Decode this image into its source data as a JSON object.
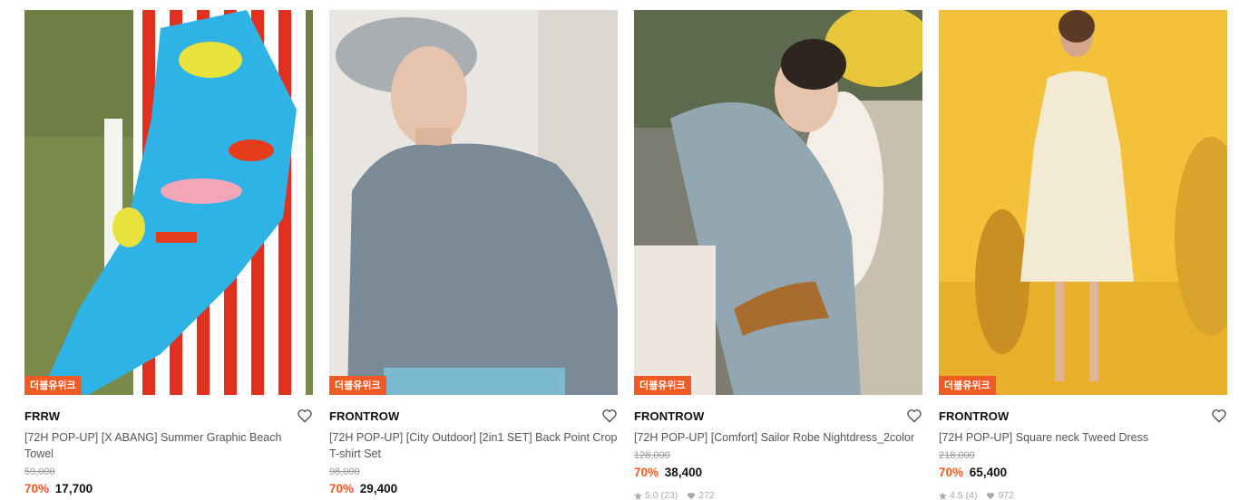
{
  "badge_label": "더블유위크",
  "products": [
    {
      "brand": "FRRW",
      "name": "[72H POP-UP] [X ABANG] Summer Graphic Beach Towel",
      "original_price": "59,000",
      "discount": "70%",
      "price": "17,700",
      "rating": "",
      "reviews": "",
      "likes": ""
    },
    {
      "brand": "FRONTROW",
      "name": "[72H POP-UP] [City Outdoor] [2in1 SET] Back Point Crop T-shirt Set",
      "original_price": "98,000",
      "discount": "70%",
      "price": "29,400",
      "rating": "",
      "reviews": "",
      "likes": ""
    },
    {
      "brand": "FRONTROW",
      "name": "[72H POP-UP] [Comfort] Sailor Robe Nightdress_2color",
      "original_price": "128,000",
      "discount": "70%",
      "price": "38,400",
      "rating": "5.0",
      "reviews": "(23)",
      "likes": "272"
    },
    {
      "brand": "FRONTROW",
      "name": "[72H POP-UP] Square neck Tweed Dress",
      "original_price": "218,000",
      "discount": "70%",
      "price": "65,400",
      "rating": "4.5",
      "reviews": "(4)",
      "likes": "972"
    }
  ],
  "colors": {
    "accent": "#f15a24"
  }
}
